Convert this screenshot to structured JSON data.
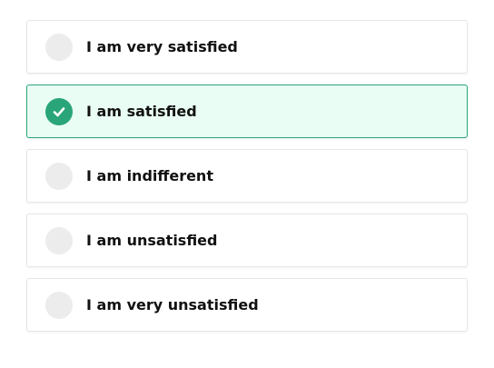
{
  "options": [
    {
      "label": "I am very satisfied",
      "selected": false
    },
    {
      "label": "I am satisfied",
      "selected": true
    },
    {
      "label": "I am indifferent",
      "selected": false
    },
    {
      "label": "I am unsatisfied",
      "selected": false
    },
    {
      "label": "I am very unsatisfied",
      "selected": false
    }
  ],
  "colors": {
    "accent": "#2aa57a",
    "selected_background": "#e9fdf4",
    "radio_unselected": "#ececec"
  },
  "icons": {
    "check": "check-icon"
  }
}
